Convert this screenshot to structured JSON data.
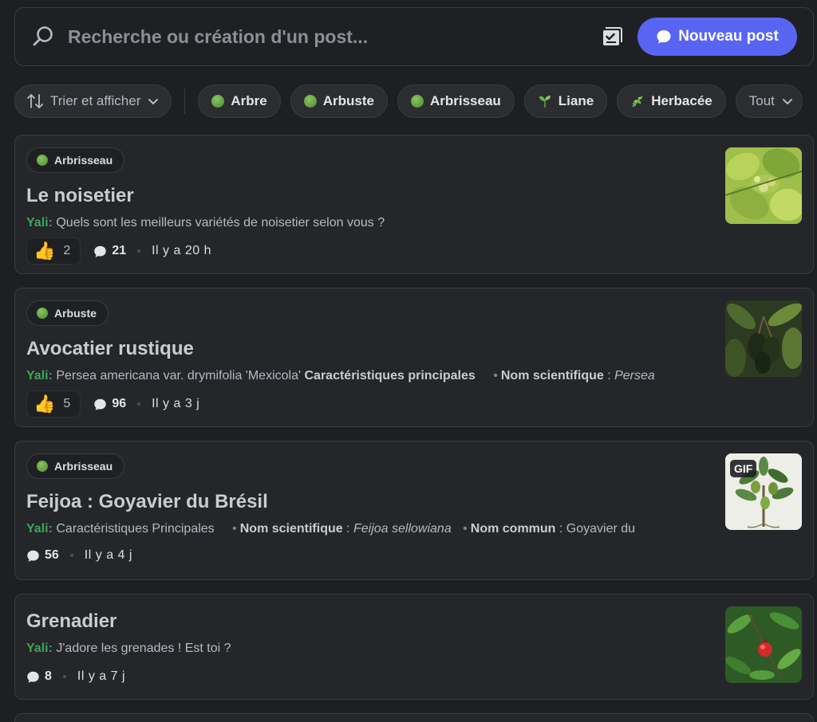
{
  "search": {
    "placeholder": "Recherche ou création d'un post...",
    "new_post_label": "Nouveau post"
  },
  "filters": {
    "sort_label": "Trier et afficher",
    "tags": [
      "Arbre",
      "Arbuste",
      "Arbrisseau",
      "Liane",
      "Herbacée"
    ],
    "more_label": "Tout"
  },
  "posts": [
    {
      "tag": "Arbrisseau",
      "title": "Le noisetier",
      "author": "Yali",
      "preview": "Quels sont les meilleurs variétés de noisetier selon vous ?",
      "likes": "2",
      "comments": "21",
      "time": "Il y a 20 h"
    },
    {
      "tag": "Arbuste",
      "title": "Avocatier rustique",
      "author": "Yali",
      "preview": "Persea americana var. drymifolia 'Mexicola'",
      "preview_bold": "Caractéristiques principales",
      "preview_label": "Nom scientifique",
      "preview_value": "Persea",
      "likes": "5",
      "comments": "96",
      "time": "Il y a 3 j"
    },
    {
      "tag": "Arbrisseau",
      "title": "Feijoa : Goyavier du Brésil",
      "author": "Yali",
      "preview": "Caractéristiques Principales",
      "preview_label": "Nom scientifique",
      "preview_value": "Feijoa sellowiana",
      "preview_label2": "Nom commun",
      "preview_value2": "Goyavier du",
      "gif_badge": "GIF",
      "comments": "56",
      "time": "Il y a 4 j"
    },
    {
      "title": "Grenadier",
      "author": "Yali",
      "preview": "J'adore les grenades ! Est toi ?",
      "comments": "8",
      "time": "Il y a 7 j"
    }
  ],
  "colors": {
    "background": "#1e1f22",
    "card": "#25262a",
    "accent": "#5865f2",
    "author": "#3ba55c"
  }
}
